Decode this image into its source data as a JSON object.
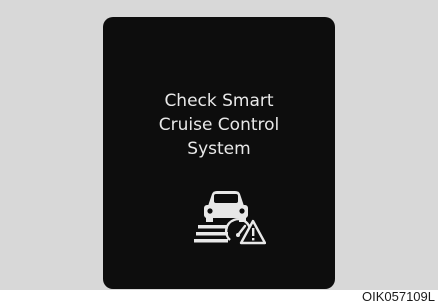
{
  "display": {
    "message_lines": [
      "Check Smart",
      "Cruise Control",
      "System"
    ],
    "icon": "smart-cruise-control-warning-icon",
    "text_color": "#e8e8e8",
    "background_color": "#0d0d0d"
  },
  "figure_code": "OIK057109L"
}
